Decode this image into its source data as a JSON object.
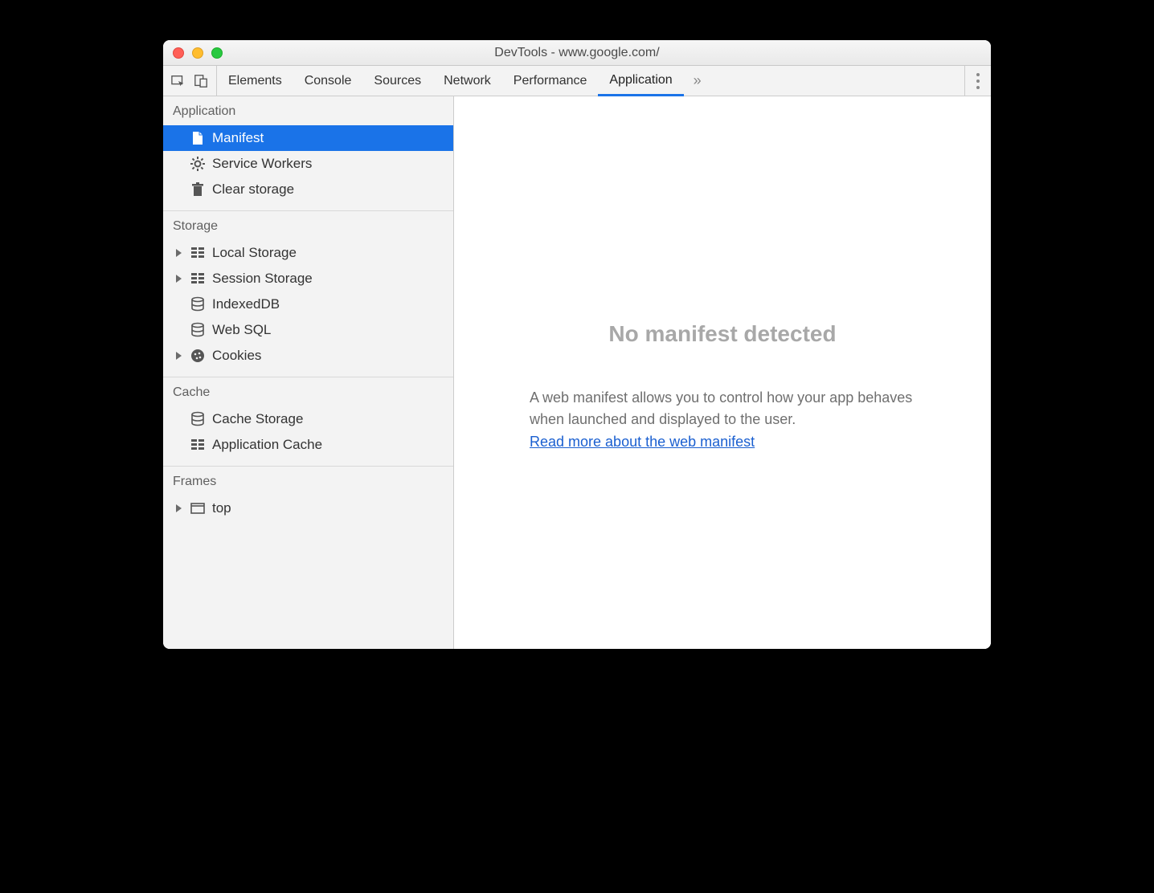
{
  "window": {
    "title": "DevTools - www.google.com/"
  },
  "tabs": {
    "items": [
      {
        "label": "Elements"
      },
      {
        "label": "Console"
      },
      {
        "label": "Sources"
      },
      {
        "label": "Network"
      },
      {
        "label": "Performance"
      },
      {
        "label": "Application"
      }
    ],
    "active_index": 5,
    "overflow_glyph": "»"
  },
  "sidebar": {
    "sections": [
      {
        "title": "Application",
        "items": [
          {
            "label": "Manifest",
            "icon": "file",
            "selected": true,
            "expandable": false
          },
          {
            "label": "Service Workers",
            "icon": "gear",
            "selected": false,
            "expandable": false
          },
          {
            "label": "Clear storage",
            "icon": "trash",
            "selected": false,
            "expandable": false
          }
        ]
      },
      {
        "title": "Storage",
        "items": [
          {
            "label": "Local Storage",
            "icon": "grid",
            "selected": false,
            "expandable": true
          },
          {
            "label": "Session Storage",
            "icon": "grid",
            "selected": false,
            "expandable": true
          },
          {
            "label": "IndexedDB",
            "icon": "db",
            "selected": false,
            "expandable": false
          },
          {
            "label": "Web SQL",
            "icon": "db",
            "selected": false,
            "expandable": false
          },
          {
            "label": "Cookies",
            "icon": "cookie",
            "selected": false,
            "expandable": true
          }
        ]
      },
      {
        "title": "Cache",
        "items": [
          {
            "label": "Cache Storage",
            "icon": "db",
            "selected": false,
            "expandable": false
          },
          {
            "label": "Application Cache",
            "icon": "grid",
            "selected": false,
            "expandable": false
          }
        ]
      },
      {
        "title": "Frames",
        "items": [
          {
            "label": "top",
            "icon": "frame",
            "selected": false,
            "expandable": true
          }
        ]
      }
    ]
  },
  "main": {
    "heading": "No manifest detected",
    "description": "A web manifest allows you to control how your app behaves when launched and displayed to the user.",
    "link_text": "Read more about the web manifest"
  }
}
